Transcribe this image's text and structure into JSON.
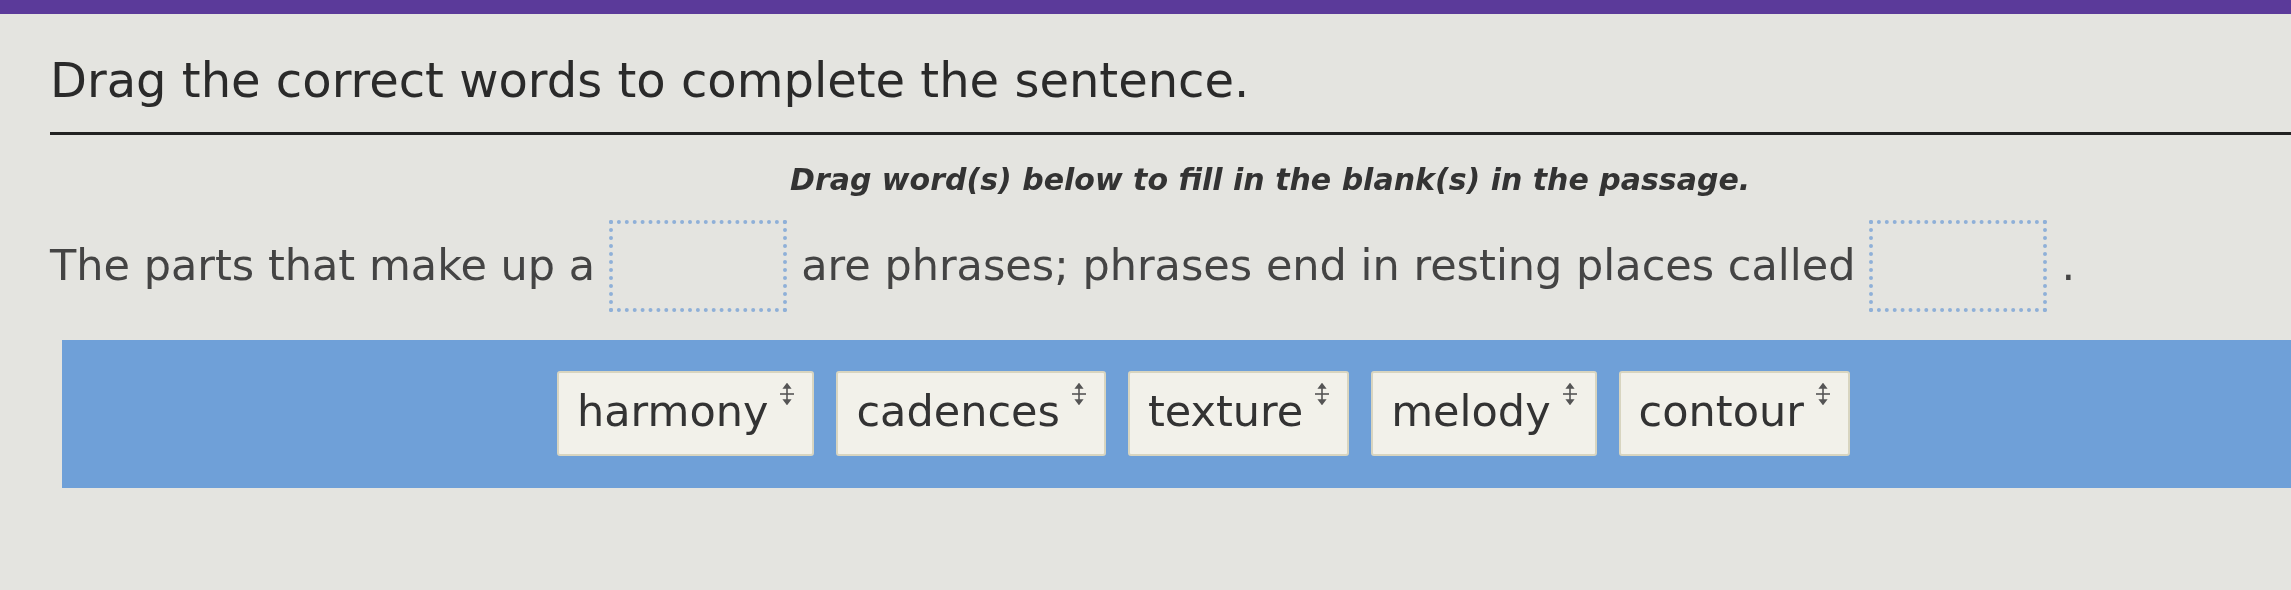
{
  "title": "Drag the correct words to complete the sentence.",
  "instruction": "Drag word(s) below to fill in the blank(s) in the passage.",
  "passage": [
    {
      "kind": "text",
      "text": "The parts that make up a"
    },
    {
      "kind": "blank"
    },
    {
      "kind": "text",
      "text": "are phrases; phrases end in resting places called"
    },
    {
      "kind": "blank"
    },
    {
      "kind": "text",
      "text": "."
    }
  ],
  "word_bank": [
    {
      "label": "harmony"
    },
    {
      "label": "cadences"
    },
    {
      "label": "texture"
    },
    {
      "label": "melody"
    },
    {
      "label": "contour"
    }
  ]
}
